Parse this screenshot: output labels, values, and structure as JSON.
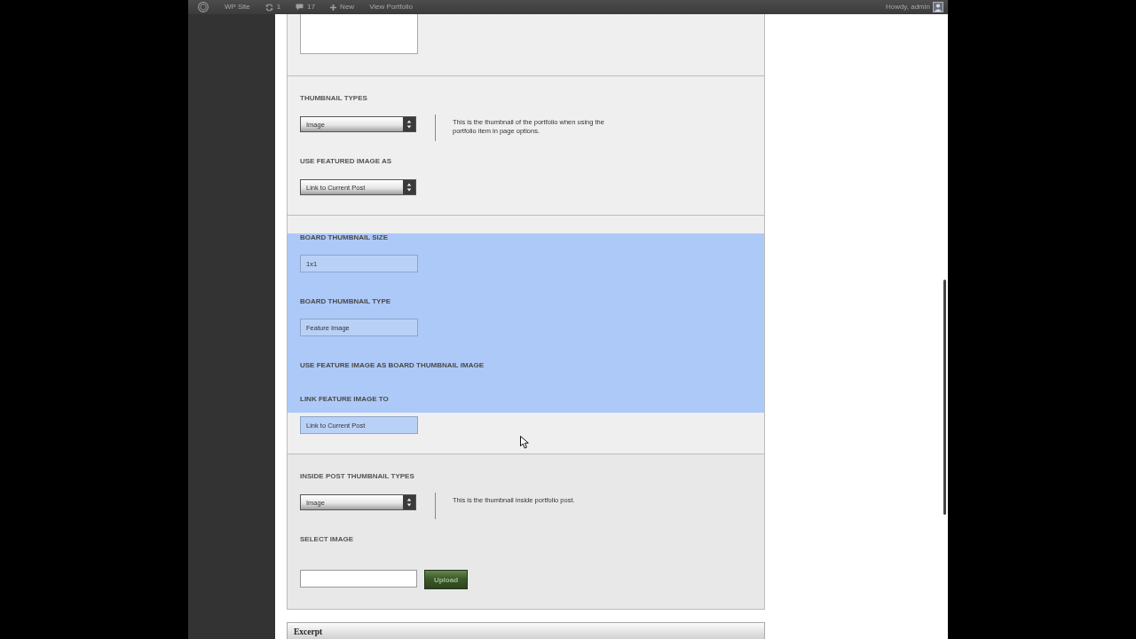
{
  "admin_bar": {
    "site_name": "WP Site",
    "updates": "1",
    "comments": "17",
    "new_label": "New",
    "view_link": "View Portfolio",
    "greeting": "Howdy, admin"
  },
  "metabox": {
    "sections": [
      {
        "highlighted": false,
        "fields": [
          {
            "kind": "textarea"
          }
        ]
      },
      {
        "highlighted": false,
        "fields": [
          {
            "kind": "select",
            "label": "THUMBNAIL TYPES",
            "value": "Image",
            "description": "This is the thumbnail of the portfolio when using the portfolio item in page options."
          },
          {
            "kind": "select",
            "label": "USE FEATURED IMAGE AS",
            "value": "Link to Current Post"
          }
        ]
      },
      {
        "highlighted": true,
        "fields": [
          {
            "kind": "text",
            "label": "BOARD THUMBNAIL SIZE",
            "value": "1x1"
          },
          {
            "kind": "text",
            "label": "BOARD THUMBNAIL TYPE",
            "value": "Feature Image"
          },
          {
            "kind": "heading",
            "label": "USE FEATURE IMAGE AS BOARD THUMBNAIL IMAGE"
          },
          {
            "kind": "text",
            "label": "LINK FEATURE IMAGE TO",
            "value": "Link to Current Post"
          }
        ]
      },
      {
        "highlighted": false,
        "fields": [
          {
            "kind": "select",
            "label": "INSIDE POST THUMBNAIL TYPES",
            "value": "Image",
            "description": "This is the thumbnail inside portfolio post."
          },
          {
            "kind": "upload",
            "label": "SELECT IMAGE",
            "button": "Upload"
          }
        ]
      }
    ]
  },
  "excerpt": {
    "title": "Excerpt"
  }
}
